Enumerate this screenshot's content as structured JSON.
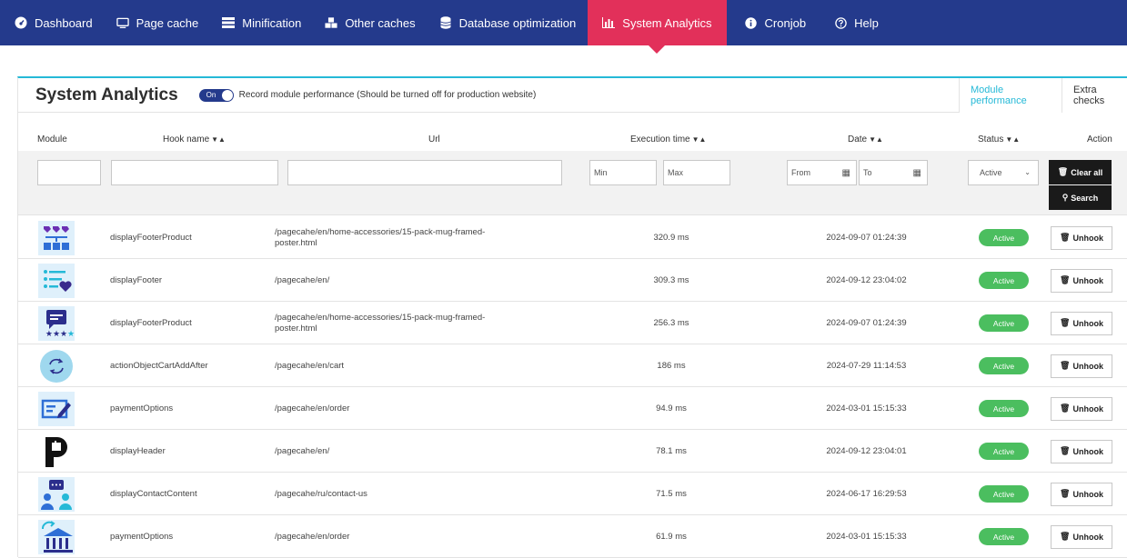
{
  "nav": [
    {
      "label": "Dashboard",
      "icon": "dashboard-icon"
    },
    {
      "label": "Page cache",
      "icon": "monitor-icon"
    },
    {
      "label": "Minification",
      "icon": "list-icon"
    },
    {
      "label": "Other caches",
      "icon": "cubes-icon"
    },
    {
      "label": "Database optimization",
      "icon": "database-icon"
    },
    {
      "label": "System Analytics",
      "icon": "chart-icon",
      "active": true
    },
    {
      "label": "Cronjob",
      "icon": "info-icon"
    },
    {
      "label": "Help",
      "icon": "help-icon"
    }
  ],
  "header": {
    "title": "System Analytics",
    "toggle_label": "On",
    "toggle_desc": "Record module performance (Should be turned off for production website)",
    "tabs": [
      "Module performance",
      "Extra checks"
    ]
  },
  "columns": {
    "module": "Module",
    "hook": "Hook name",
    "url": "Url",
    "exec": "Execution time",
    "date": "Date",
    "status": "Status",
    "action": "Action"
  },
  "filters": {
    "min_placeholder": "Min",
    "max_placeholder": "Max",
    "from_placeholder": "From",
    "to_placeholder": "To",
    "status_value": "Active",
    "clear_label": "Clear all",
    "search_label": "Search"
  },
  "rows": [
    {
      "hook": "displayFooterProduct",
      "url": "/pagecahe/en/home-accessories/15-pack-mug-framed-poster.html",
      "url1": "/pagecahe/en/home-accessories/15-pack-mug-framed-",
      "url2": "poster.html",
      "time": "320.9 ms",
      "date": "2024-09-07 01:24:39",
      "status": "Active",
      "action": "Unhook"
    },
    {
      "hook": "displayFooter",
      "url1": "/pagecahe/en/",
      "url2": "",
      "time": "309.3 ms",
      "date": "2024-09-12 23:04:02",
      "status": "Active",
      "action": "Unhook"
    },
    {
      "hook": "displayFooterProduct",
      "url1": "/pagecahe/en/home-accessories/15-pack-mug-framed-",
      "url2": "poster.html",
      "time": "256.3 ms",
      "date": "2024-09-07 01:24:39",
      "status": "Active",
      "action": "Unhook"
    },
    {
      "hook": "actionObjectCartAddAfter",
      "url1": "/pagecahe/en/cart",
      "url2": "",
      "time": "186 ms",
      "date": "2024-07-29 11:14:53",
      "status": "Active",
      "action": "Unhook"
    },
    {
      "hook": "paymentOptions",
      "url1": "/pagecahe/en/order",
      "url2": "",
      "time": "94.9 ms",
      "date": "2024-03-01 15:15:33",
      "status": "Active",
      "action": "Unhook"
    },
    {
      "hook": "displayHeader",
      "url1": "/pagecahe/en/",
      "url2": "",
      "time": "78.1 ms",
      "date": "2024-09-12 23:04:01",
      "status": "Active",
      "action": "Unhook"
    },
    {
      "hook": "displayContactContent",
      "url1": "/pagecahe/ru/contact-us",
      "url2": "",
      "time": "71.5 ms",
      "date": "2024-06-17 16:29:53",
      "status": "Active",
      "action": "Unhook"
    },
    {
      "hook": "paymentOptions",
      "url1": "/pagecahe/en/order",
      "url2": "",
      "time": "61.9 ms",
      "date": "2024-03-01 15:15:33",
      "status": "Active",
      "action": "Unhook"
    }
  ]
}
